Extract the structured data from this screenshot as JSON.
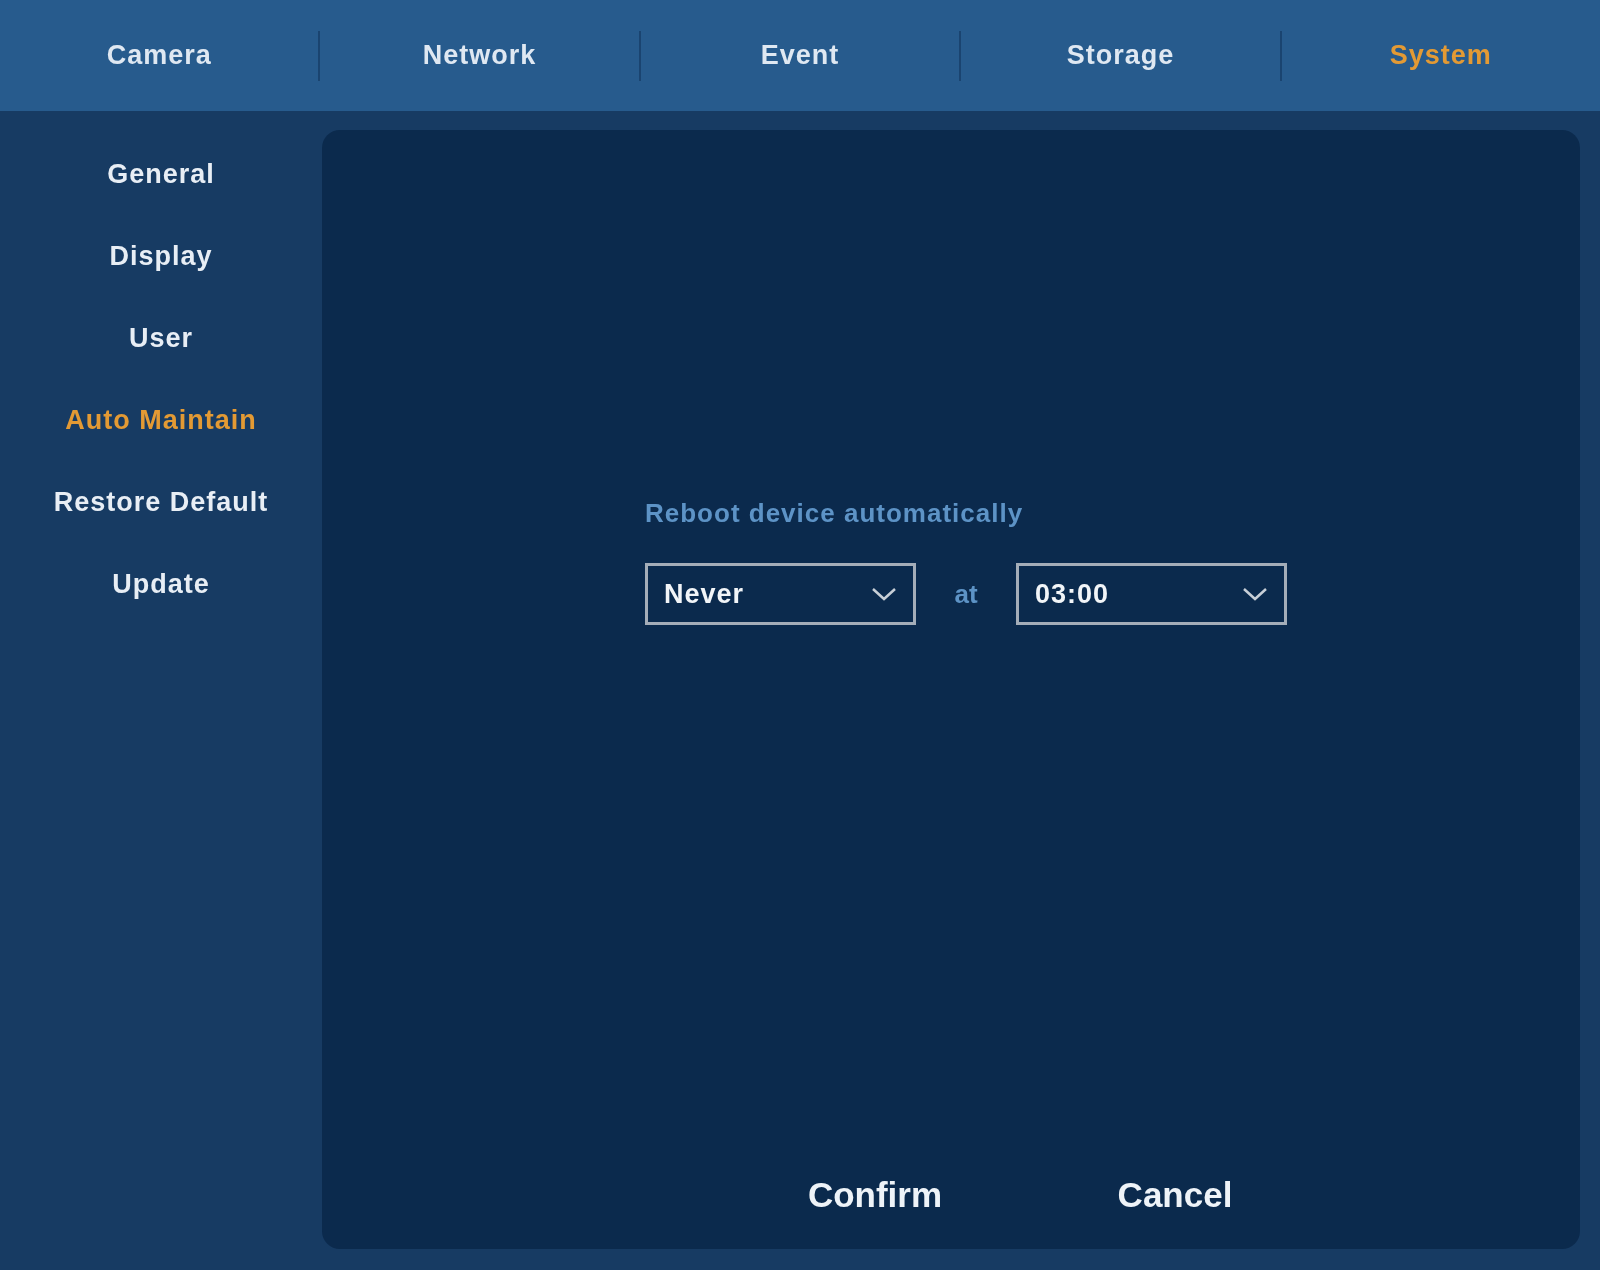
{
  "tabs": [
    {
      "label": "Camera",
      "selected": false
    },
    {
      "label": "Network",
      "selected": false
    },
    {
      "label": "Event",
      "selected": false
    },
    {
      "label": "Storage",
      "selected": false
    },
    {
      "label": "System",
      "selected": true
    }
  ],
  "sidebar": {
    "items": [
      {
        "label": "General",
        "selected": false
      },
      {
        "label": "Display",
        "selected": false
      },
      {
        "label": "User",
        "selected": false
      },
      {
        "label": "Auto Maintain",
        "selected": true
      },
      {
        "label": "Restore Default",
        "selected": false
      },
      {
        "label": "Update",
        "selected": false
      }
    ]
  },
  "reboot": {
    "label": "Reboot device automatically",
    "frequency": "Never",
    "at_label": "at",
    "time": "03:00"
  },
  "buttons": [
    "Confirm",
    "Cancel"
  ]
}
